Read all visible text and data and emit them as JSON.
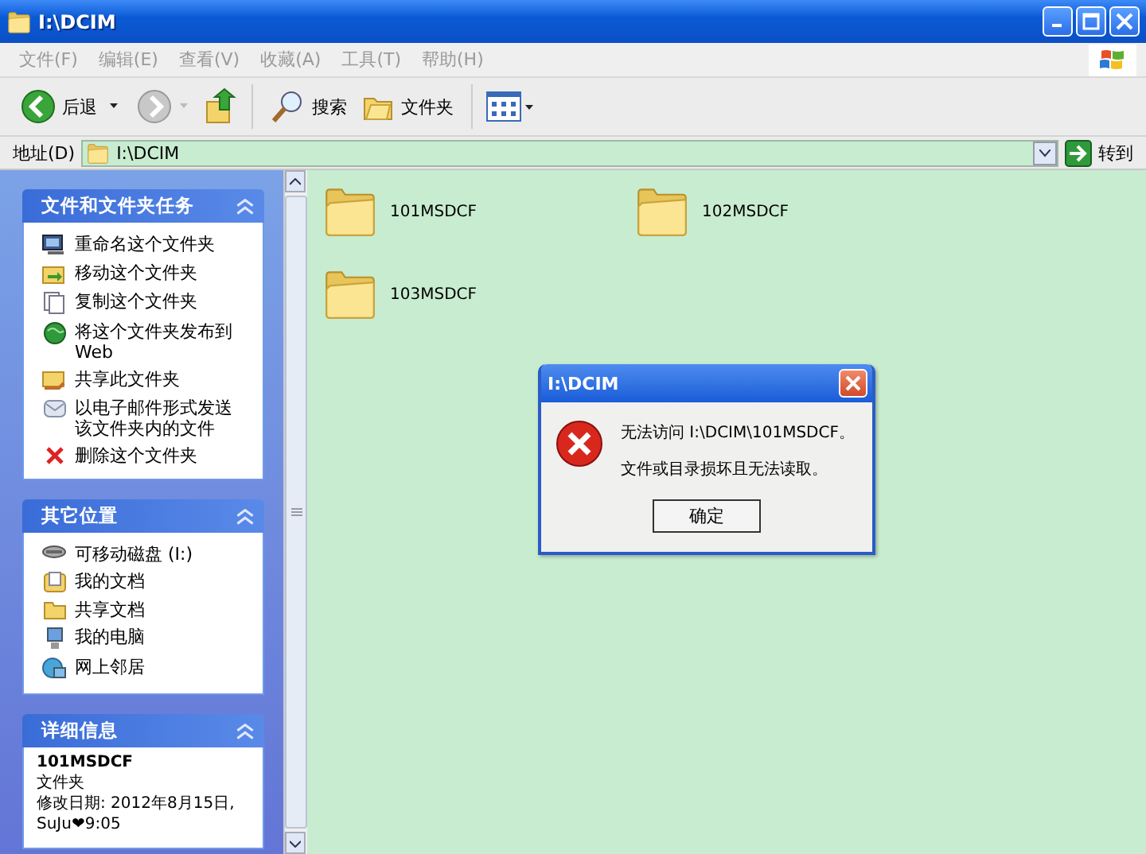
{
  "window": {
    "title": "I:\\DCIM"
  },
  "menu": [
    "文件(F)",
    "编辑(E)",
    "查看(V)",
    "收藏(A)",
    "工具(T)",
    "帮助(H)"
  ],
  "toolbar": {
    "back": "后退",
    "search": "搜索",
    "folders": "文件夹"
  },
  "address": {
    "label": "地址(D)",
    "value": "I:\\DCIM",
    "go": "转到"
  },
  "task_panels": [
    {
      "title": "文件和文件夹任务",
      "items": [
        {
          "label": "重命名这个文件夹",
          "kind": "rename"
        },
        {
          "label": "移动这个文件夹",
          "kind": "move"
        },
        {
          "label": "复制这个文件夹",
          "kind": "copy"
        },
        {
          "label": "将这个文件夹发布到 Web",
          "kind": "web"
        },
        {
          "label": "共享此文件夹",
          "kind": "share"
        },
        {
          "label": "以电子邮件形式发送该文件夹内的文件",
          "kind": "email"
        },
        {
          "label": "删除这个文件夹",
          "kind": "delete"
        }
      ]
    },
    {
      "title": "其它位置",
      "items": [
        {
          "label": "可移动磁盘 (I:)",
          "kind": "drive"
        },
        {
          "label": "我的文档",
          "kind": "documents"
        },
        {
          "label": "共享文档",
          "kind": "folder"
        },
        {
          "label": "我的电脑",
          "kind": "computer"
        },
        {
          "label": "网上邻居",
          "kind": "network"
        }
      ]
    },
    {
      "title": "详细信息",
      "details": {
        "name": "101MSDCF",
        "type": "文件夹",
        "modified_date": "修改日期: 2012年8月15日,",
        "modified_time": "SuJu❤9:05"
      }
    }
  ],
  "folders": [
    {
      "name": "101MSDCF"
    },
    {
      "name": "102MSDCF"
    },
    {
      "name": "103MSDCF"
    }
  ],
  "dialog": {
    "title": "I:\\DCIM",
    "lines": [
      "无法访问 I:\\DCIM\\101MSDCF。",
      "文件或目录损坏且无法读取。"
    ],
    "button": "确定"
  }
}
